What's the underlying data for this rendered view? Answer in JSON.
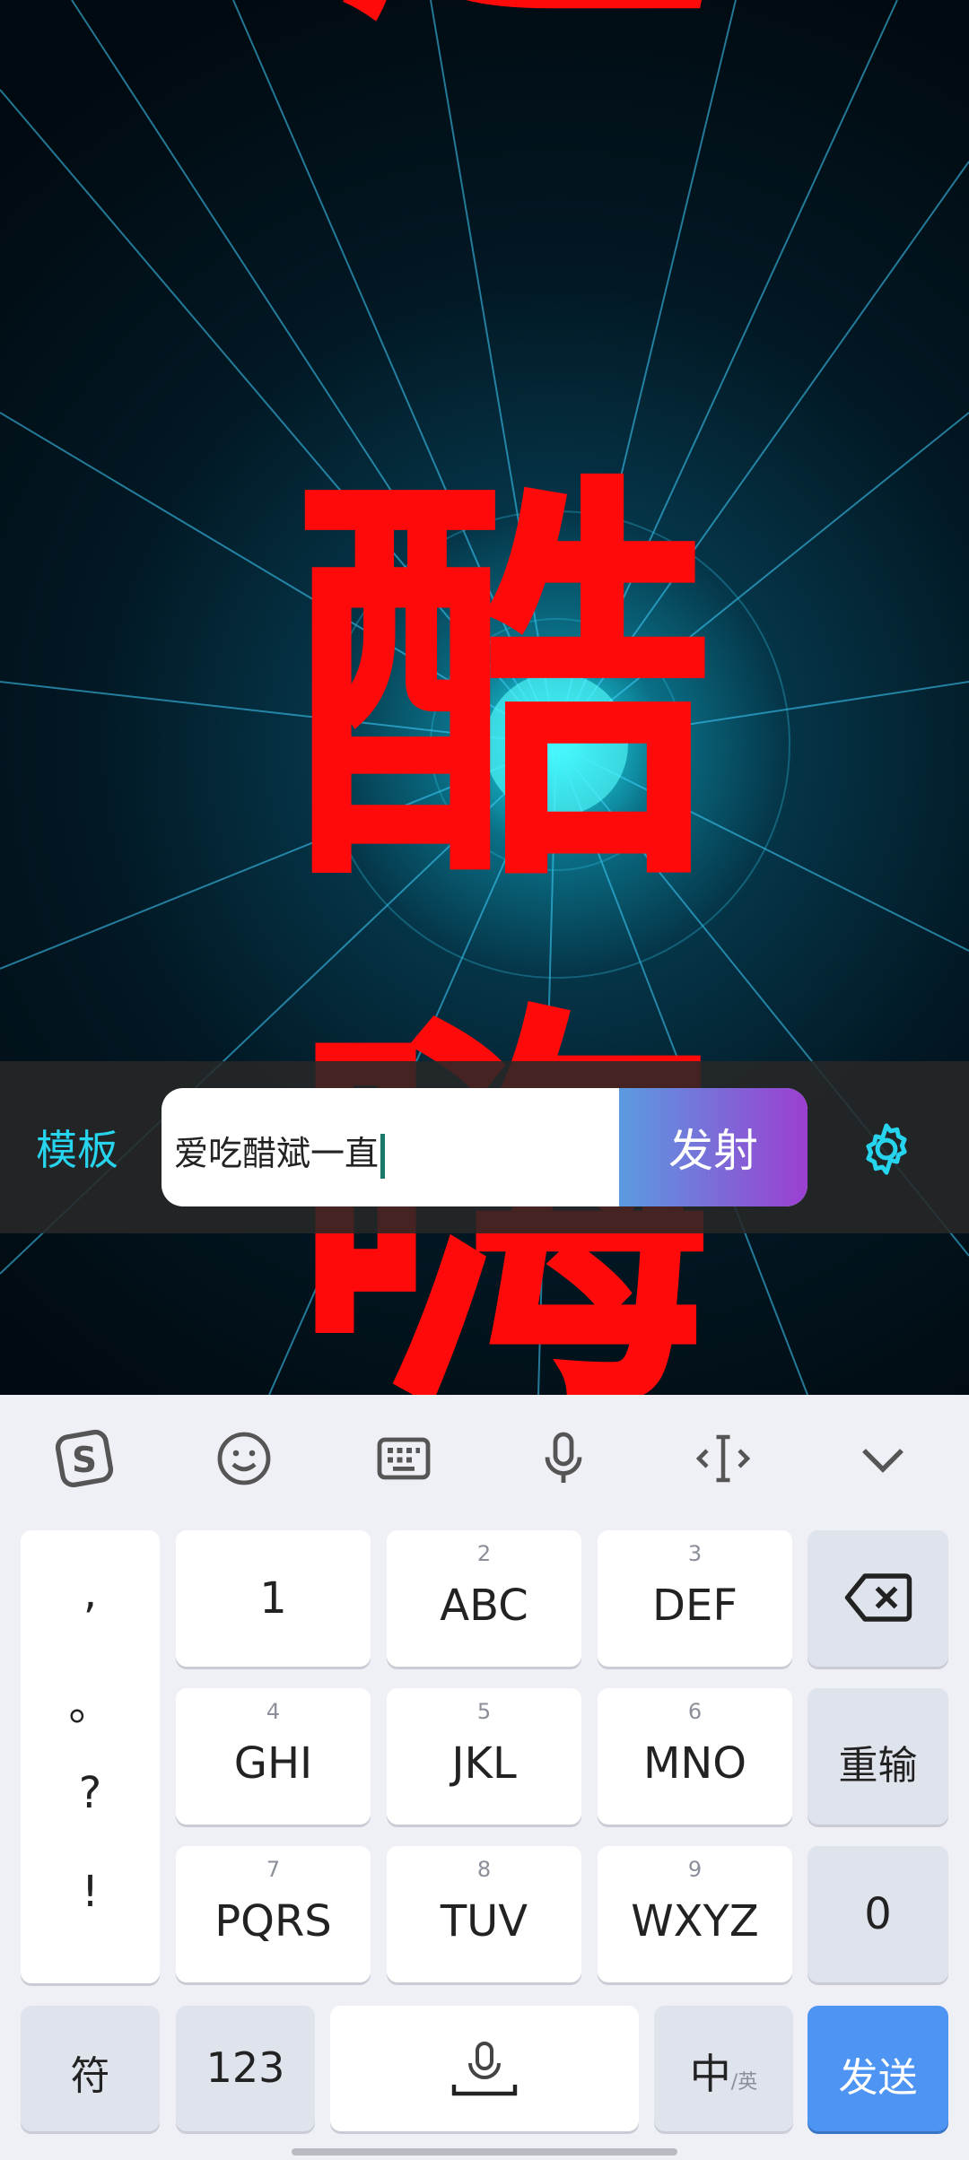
{
  "video_text": {
    "big_chars": [
      "超",
      "酷",
      "嗨"
    ]
  },
  "input_bar": {
    "template_label": "模板",
    "input_value": "爱吃醋斌一直",
    "fire_button": "发射",
    "settings_icon": "gear-icon"
  },
  "keyboard": {
    "toolbar": [
      "sogou-logo-icon",
      "emoji-icon",
      "keyboard-icon",
      "microphone-icon",
      "cursor-icon",
      "chevron-down-icon"
    ],
    "punct": [
      ",",
      "。",
      "?",
      "!"
    ],
    "keys": [
      {
        "num": "",
        "label": "1"
      },
      {
        "num": "2",
        "label": "ABC"
      },
      {
        "num": "3",
        "label": "DEF"
      },
      {
        "num": "4",
        "label": "GHI"
      },
      {
        "num": "5",
        "label": "JKL"
      },
      {
        "num": "6",
        "label": "MNO"
      },
      {
        "num": "7",
        "label": "PQRS"
      },
      {
        "num": "8",
        "label": "TUV"
      },
      {
        "num": "9",
        "label": "WXYZ"
      }
    ],
    "reset": "重输",
    "zero": "0",
    "symbols": "符",
    "num_mode": "123",
    "lang_main": "中",
    "lang_sub": "/英",
    "send": "发送"
  },
  "colors": {
    "accent": "#27d4ee",
    "send": "#4e94f3",
    "red_text": "#ff0a0a"
  }
}
